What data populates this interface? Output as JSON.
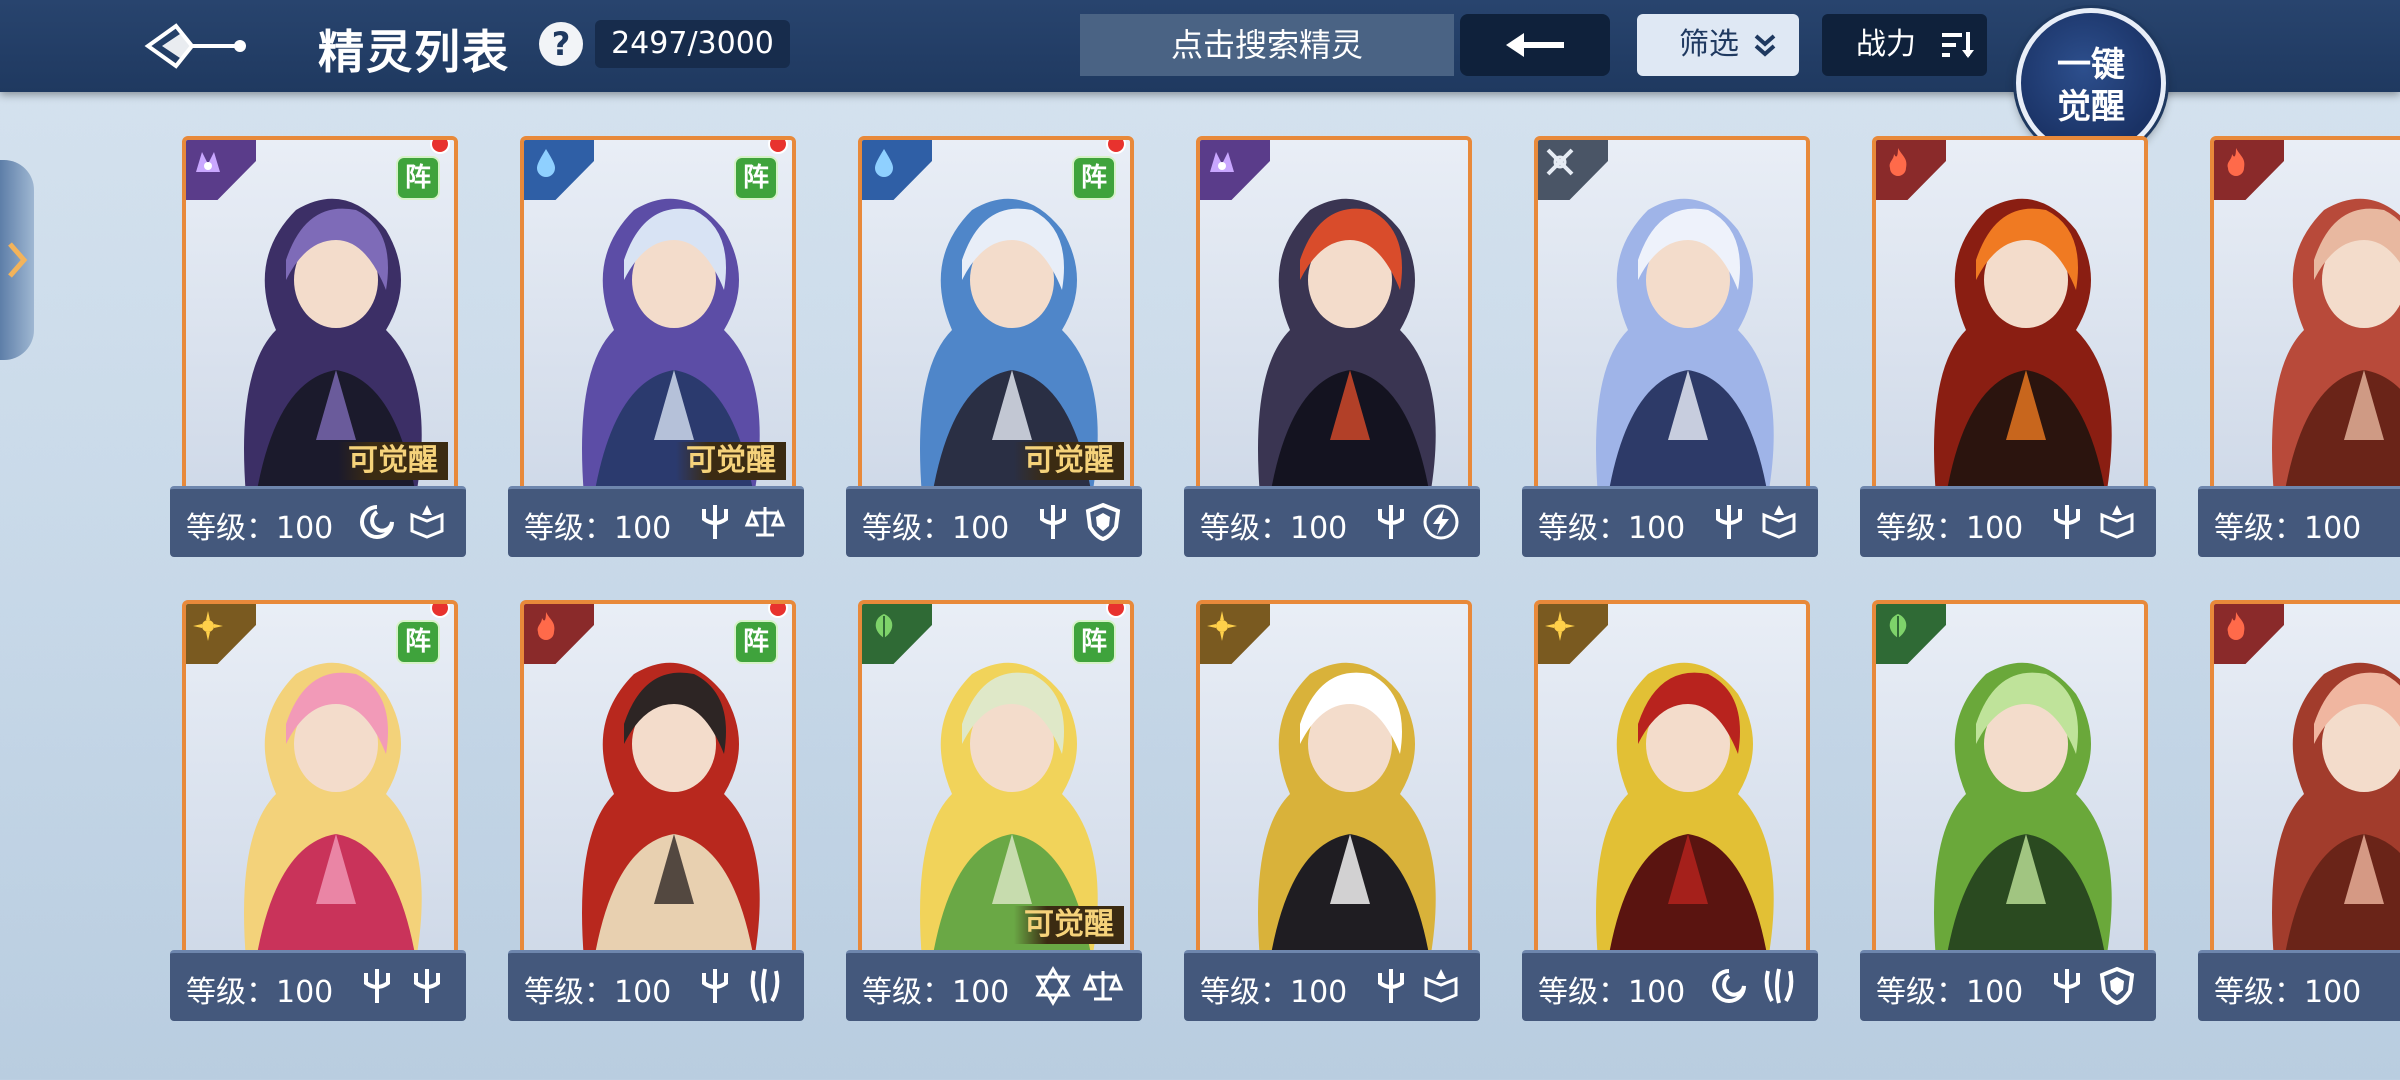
{
  "header": {
    "title": "精灵列表",
    "help": "?",
    "count": "2497/3000",
    "search_placeholder": "点击搜索精灵",
    "filter_label": "筛选",
    "power_label": "战力",
    "awaken_all_line1": "一键",
    "awaken_all_line2": "觉醒"
  },
  "card_labels": {
    "level": "等级：100",
    "formation": "阵",
    "awakenable": "可觉醒"
  },
  "colors": {
    "topbar": "#1f3960",
    "card_border": "#e8893a",
    "formation_badge": "#3fa33c",
    "awaken_text": "#f5d27a"
  },
  "cards": [
    {
      "element": "dark-element-icon",
      "formation": true,
      "awakenable": true,
      "skills": [
        "swirl-icon",
        "book-icon"
      ]
    },
    {
      "element": "water-element-icon",
      "formation": true,
      "awakenable": true,
      "skills": [
        "trident-icon",
        "scale-icon"
      ]
    },
    {
      "element": "water-element-icon",
      "formation": true,
      "awakenable": true,
      "skills": [
        "trident-icon",
        "shield-icon"
      ]
    },
    {
      "element": "dark-element-icon",
      "formation": false,
      "awakenable": false,
      "skills": [
        "trident-icon",
        "lightning-icon"
      ]
    },
    {
      "element": "neutral-element-icon",
      "formation": false,
      "awakenable": false,
      "skills": [
        "trident-icon",
        "book-icon"
      ]
    },
    {
      "element": "fire-element-icon",
      "formation": false,
      "awakenable": false,
      "skills": [
        "trident-icon",
        "book-icon"
      ]
    },
    {
      "element": "fire-element-icon",
      "formation": false,
      "awakenable": false,
      "skills": []
    },
    {
      "element": "light-element-icon",
      "formation": true,
      "awakenable": false,
      "skills": [
        "trident-icon",
        "trident-icon"
      ]
    },
    {
      "element": "fire-element-icon",
      "formation": true,
      "awakenable": false,
      "skills": [
        "trident-icon",
        "claw-icon"
      ]
    },
    {
      "element": "grass-element-icon",
      "formation": true,
      "awakenable": true,
      "skills": [
        "star-icon",
        "scale-icon"
      ]
    },
    {
      "element": "light-element-icon",
      "formation": false,
      "awakenable": false,
      "skills": [
        "trident-icon",
        "book-icon"
      ]
    },
    {
      "element": "light-element-icon",
      "formation": false,
      "awakenable": false,
      "skills": [
        "swirl-icon",
        "claw-icon"
      ]
    },
    {
      "element": "grass-element-icon",
      "formation": false,
      "awakenable": false,
      "skills": [
        "trident-icon",
        "shield-icon"
      ]
    },
    {
      "element": "fire-element-icon",
      "formation": false,
      "awakenable": false,
      "skills": []
    }
  ]
}
